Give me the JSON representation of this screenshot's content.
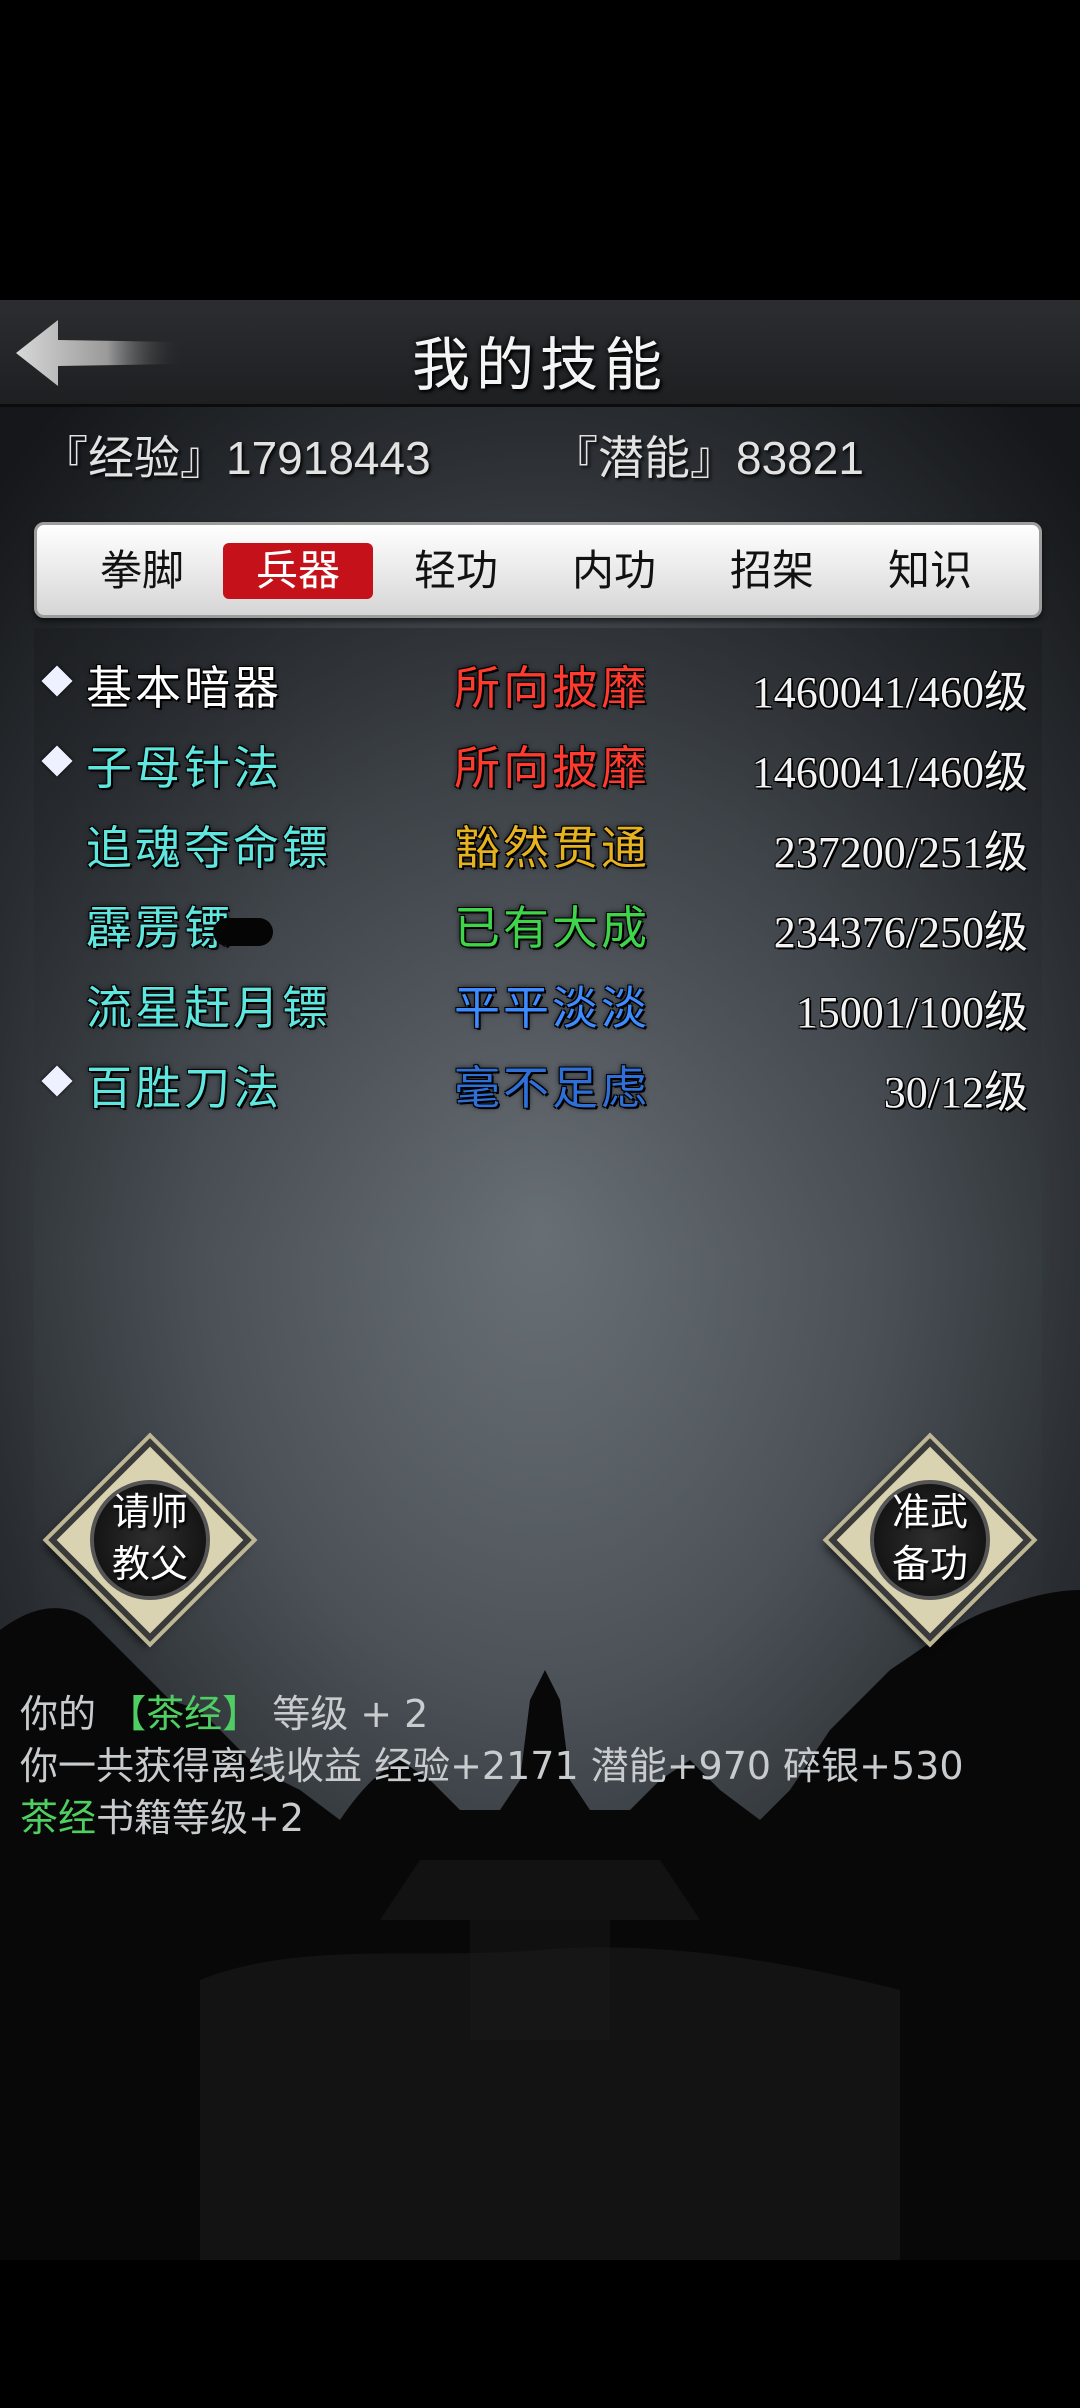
{
  "header": {
    "title": "我的技能",
    "back_icon": "back-arrow-icon"
  },
  "stats": {
    "exp_label": "『经验』17918443",
    "potential_label": "『潜能』83821"
  },
  "tabs": [
    {
      "label": "拳脚",
      "active": false
    },
    {
      "label": "兵器",
      "active": true
    },
    {
      "label": "轻功",
      "active": false
    },
    {
      "label": "内功",
      "active": false
    },
    {
      "label": "招架",
      "active": false
    },
    {
      "label": "知识",
      "active": false
    }
  ],
  "skills": [
    {
      "name": "基本暗器",
      "rank": "所向披靡",
      "level": "1460041/460级",
      "marked": true,
      "name_color": "#ffffff",
      "rank_color": "#ff3b30"
    },
    {
      "name": "子母针法",
      "rank": "所向披靡",
      "level": "1460041/460级",
      "marked": true,
      "name_color": "#5fe6df",
      "rank_color": "#ff3b30"
    },
    {
      "name": "追魂夺命镖",
      "rank": "豁然贯通",
      "level": "237200/251级",
      "marked": false,
      "name_color": "#5fe6df",
      "rank_color": "#e6b21f"
    },
    {
      "name": "霹雳镖",
      "rank": "已有大成",
      "level": "234376/250级",
      "marked": false,
      "name_color": "#5fe6df",
      "rank_color": "#3fd44a"
    },
    {
      "name": "流星赶月镖",
      "rank": "平平淡淡",
      "level": "15001/100级",
      "marked": false,
      "name_color": "#5fe6df",
      "rank_color": "#3d8bff"
    },
    {
      "name": "百胜刀法",
      "rank": "毫不足虑",
      "level": "30/12级",
      "marked": true,
      "name_color": "#5fe6df",
      "rank_color": "#2e6fd8"
    }
  ],
  "buttons": {
    "left": {
      "line1": "请师",
      "line2": "教父"
    },
    "right": {
      "line1": "准武",
      "line2": "备功"
    }
  },
  "log": {
    "line1_prefix": "你的 ",
    "line1_item": "【茶经】",
    "line1_suffix": " 等级 + 2",
    "line2": "你一共获得离线收益 经验+2171 潜能+970 碎银+530",
    "line3_item": "茶经",
    "line3_suffix": "书籍等级+2"
  },
  "colors": {
    "accent_red": "#c5121a",
    "log_green": "#4fcf62"
  }
}
